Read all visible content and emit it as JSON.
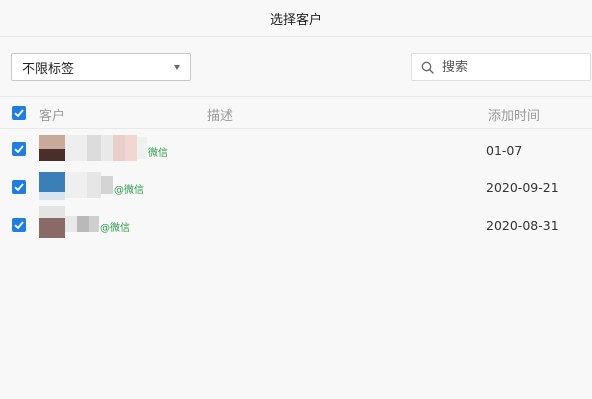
{
  "dialog": {
    "title": "选择客户"
  },
  "filter": {
    "selected": "不限标签"
  },
  "search": {
    "placeholder": "搜索"
  },
  "table": {
    "headers": {
      "customer": "客户",
      "description": "描述",
      "added_time": "添加时间"
    },
    "rows": [
      {
        "source": "微信",
        "date": "01-07",
        "checked": true
      },
      {
        "source": "@微信",
        "date": "2020-09-21",
        "checked": true
      },
      {
        "source": "@微信",
        "date": "2020-08-31",
        "checked": true
      }
    ]
  },
  "colors": {
    "accent": "#1f7ee0",
    "wechat_green": "#2a9a4a"
  },
  "icons": {
    "search": "search-icon",
    "checkbox": "checkmark-icon",
    "dropdown": "caret-down-icon"
  }
}
